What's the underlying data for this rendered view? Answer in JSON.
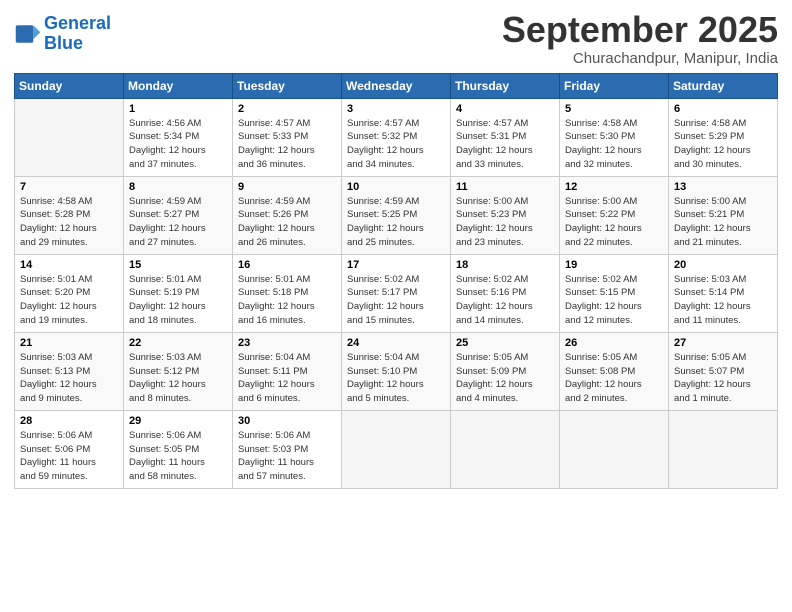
{
  "header": {
    "logo_line1": "General",
    "logo_line2": "Blue",
    "month_title": "September 2025",
    "subtitle": "Churachandpur, Manipur, India"
  },
  "days_of_week": [
    "Sunday",
    "Monday",
    "Tuesday",
    "Wednesday",
    "Thursday",
    "Friday",
    "Saturday"
  ],
  "weeks": [
    [
      {
        "day": "",
        "info": ""
      },
      {
        "day": "1",
        "info": "Sunrise: 4:56 AM\nSunset: 5:34 PM\nDaylight: 12 hours\nand 37 minutes."
      },
      {
        "day": "2",
        "info": "Sunrise: 4:57 AM\nSunset: 5:33 PM\nDaylight: 12 hours\nand 36 minutes."
      },
      {
        "day": "3",
        "info": "Sunrise: 4:57 AM\nSunset: 5:32 PM\nDaylight: 12 hours\nand 34 minutes."
      },
      {
        "day": "4",
        "info": "Sunrise: 4:57 AM\nSunset: 5:31 PM\nDaylight: 12 hours\nand 33 minutes."
      },
      {
        "day": "5",
        "info": "Sunrise: 4:58 AM\nSunset: 5:30 PM\nDaylight: 12 hours\nand 32 minutes."
      },
      {
        "day": "6",
        "info": "Sunrise: 4:58 AM\nSunset: 5:29 PM\nDaylight: 12 hours\nand 30 minutes."
      }
    ],
    [
      {
        "day": "7",
        "info": "Sunrise: 4:58 AM\nSunset: 5:28 PM\nDaylight: 12 hours\nand 29 minutes."
      },
      {
        "day": "8",
        "info": "Sunrise: 4:59 AM\nSunset: 5:27 PM\nDaylight: 12 hours\nand 27 minutes."
      },
      {
        "day": "9",
        "info": "Sunrise: 4:59 AM\nSunset: 5:26 PM\nDaylight: 12 hours\nand 26 minutes."
      },
      {
        "day": "10",
        "info": "Sunrise: 4:59 AM\nSunset: 5:25 PM\nDaylight: 12 hours\nand 25 minutes."
      },
      {
        "day": "11",
        "info": "Sunrise: 5:00 AM\nSunset: 5:23 PM\nDaylight: 12 hours\nand 23 minutes."
      },
      {
        "day": "12",
        "info": "Sunrise: 5:00 AM\nSunset: 5:22 PM\nDaylight: 12 hours\nand 22 minutes."
      },
      {
        "day": "13",
        "info": "Sunrise: 5:00 AM\nSunset: 5:21 PM\nDaylight: 12 hours\nand 21 minutes."
      }
    ],
    [
      {
        "day": "14",
        "info": "Sunrise: 5:01 AM\nSunset: 5:20 PM\nDaylight: 12 hours\nand 19 minutes."
      },
      {
        "day": "15",
        "info": "Sunrise: 5:01 AM\nSunset: 5:19 PM\nDaylight: 12 hours\nand 18 minutes."
      },
      {
        "day": "16",
        "info": "Sunrise: 5:01 AM\nSunset: 5:18 PM\nDaylight: 12 hours\nand 16 minutes."
      },
      {
        "day": "17",
        "info": "Sunrise: 5:02 AM\nSunset: 5:17 PM\nDaylight: 12 hours\nand 15 minutes."
      },
      {
        "day": "18",
        "info": "Sunrise: 5:02 AM\nSunset: 5:16 PM\nDaylight: 12 hours\nand 14 minutes."
      },
      {
        "day": "19",
        "info": "Sunrise: 5:02 AM\nSunset: 5:15 PM\nDaylight: 12 hours\nand 12 minutes."
      },
      {
        "day": "20",
        "info": "Sunrise: 5:03 AM\nSunset: 5:14 PM\nDaylight: 12 hours\nand 11 minutes."
      }
    ],
    [
      {
        "day": "21",
        "info": "Sunrise: 5:03 AM\nSunset: 5:13 PM\nDaylight: 12 hours\nand 9 minutes."
      },
      {
        "day": "22",
        "info": "Sunrise: 5:03 AM\nSunset: 5:12 PM\nDaylight: 12 hours\nand 8 minutes."
      },
      {
        "day": "23",
        "info": "Sunrise: 5:04 AM\nSunset: 5:11 PM\nDaylight: 12 hours\nand 6 minutes."
      },
      {
        "day": "24",
        "info": "Sunrise: 5:04 AM\nSunset: 5:10 PM\nDaylight: 12 hours\nand 5 minutes."
      },
      {
        "day": "25",
        "info": "Sunrise: 5:05 AM\nSunset: 5:09 PM\nDaylight: 12 hours\nand 4 minutes."
      },
      {
        "day": "26",
        "info": "Sunrise: 5:05 AM\nSunset: 5:08 PM\nDaylight: 12 hours\nand 2 minutes."
      },
      {
        "day": "27",
        "info": "Sunrise: 5:05 AM\nSunset: 5:07 PM\nDaylight: 12 hours\nand 1 minute."
      }
    ],
    [
      {
        "day": "28",
        "info": "Sunrise: 5:06 AM\nSunset: 5:06 PM\nDaylight: 11 hours\nand 59 minutes."
      },
      {
        "day": "29",
        "info": "Sunrise: 5:06 AM\nSunset: 5:05 PM\nDaylight: 11 hours\nand 58 minutes."
      },
      {
        "day": "30",
        "info": "Sunrise: 5:06 AM\nSunset: 5:03 PM\nDaylight: 11 hours\nand 57 minutes."
      },
      {
        "day": "",
        "info": ""
      },
      {
        "day": "",
        "info": ""
      },
      {
        "day": "",
        "info": ""
      },
      {
        "day": "",
        "info": ""
      }
    ]
  ]
}
